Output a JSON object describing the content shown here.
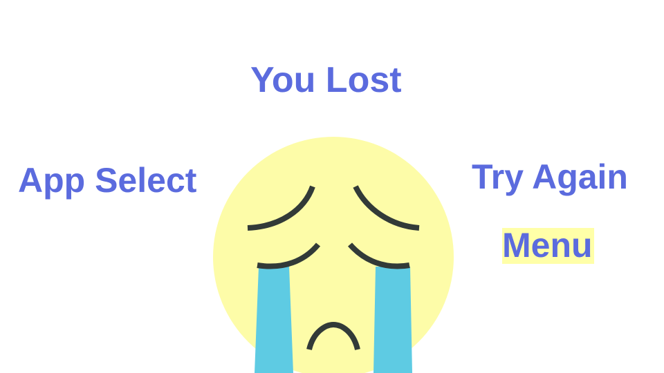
{
  "screen": {
    "title": "You Lost",
    "buttons": {
      "app_select": "App Select",
      "try_again": "Try Again",
      "menu": "Menu"
    }
  },
  "colors": {
    "text": "#5b6bde",
    "face": "#fdfca8",
    "tears": "#5ecbe3",
    "features": "#323a38",
    "menu_highlight": "#ffffa8",
    "background": "#ffffff"
  },
  "icons": {
    "face": "crying-face-icon"
  }
}
